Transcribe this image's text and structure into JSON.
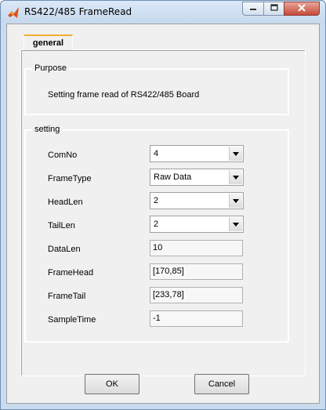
{
  "window": {
    "title": "RS422/485 FrameRead"
  },
  "tabs": [
    {
      "label": "general"
    }
  ],
  "purpose": {
    "title": "Purpose",
    "text": "Setting frame read of RS422/485 Board"
  },
  "setting": {
    "title": "setting",
    "fields": {
      "comno": {
        "label": "ComNo",
        "value": "4"
      },
      "frametype": {
        "label": "FrameType",
        "value": "Raw Data"
      },
      "headlen": {
        "label": "HeadLen",
        "value": "2"
      },
      "taillen": {
        "label": "TailLen",
        "value": "2"
      },
      "datalen": {
        "label": "DataLen",
        "value": "10"
      },
      "framehead": {
        "label": "FrameHead",
        "value": "[170,85]"
      },
      "frametail": {
        "label": "FrameTail",
        "value": "[233,78]"
      },
      "sampletime": {
        "label": "SampleTime",
        "value": "-1"
      }
    }
  },
  "buttons": {
    "ok": "OK",
    "cancel": "Cancel"
  },
  "icons": {
    "app": "matlab-icon",
    "minimize": "minimize-icon",
    "maximize": "maximize-icon",
    "close": "close-icon",
    "dropdown": "chevron-down-icon"
  }
}
